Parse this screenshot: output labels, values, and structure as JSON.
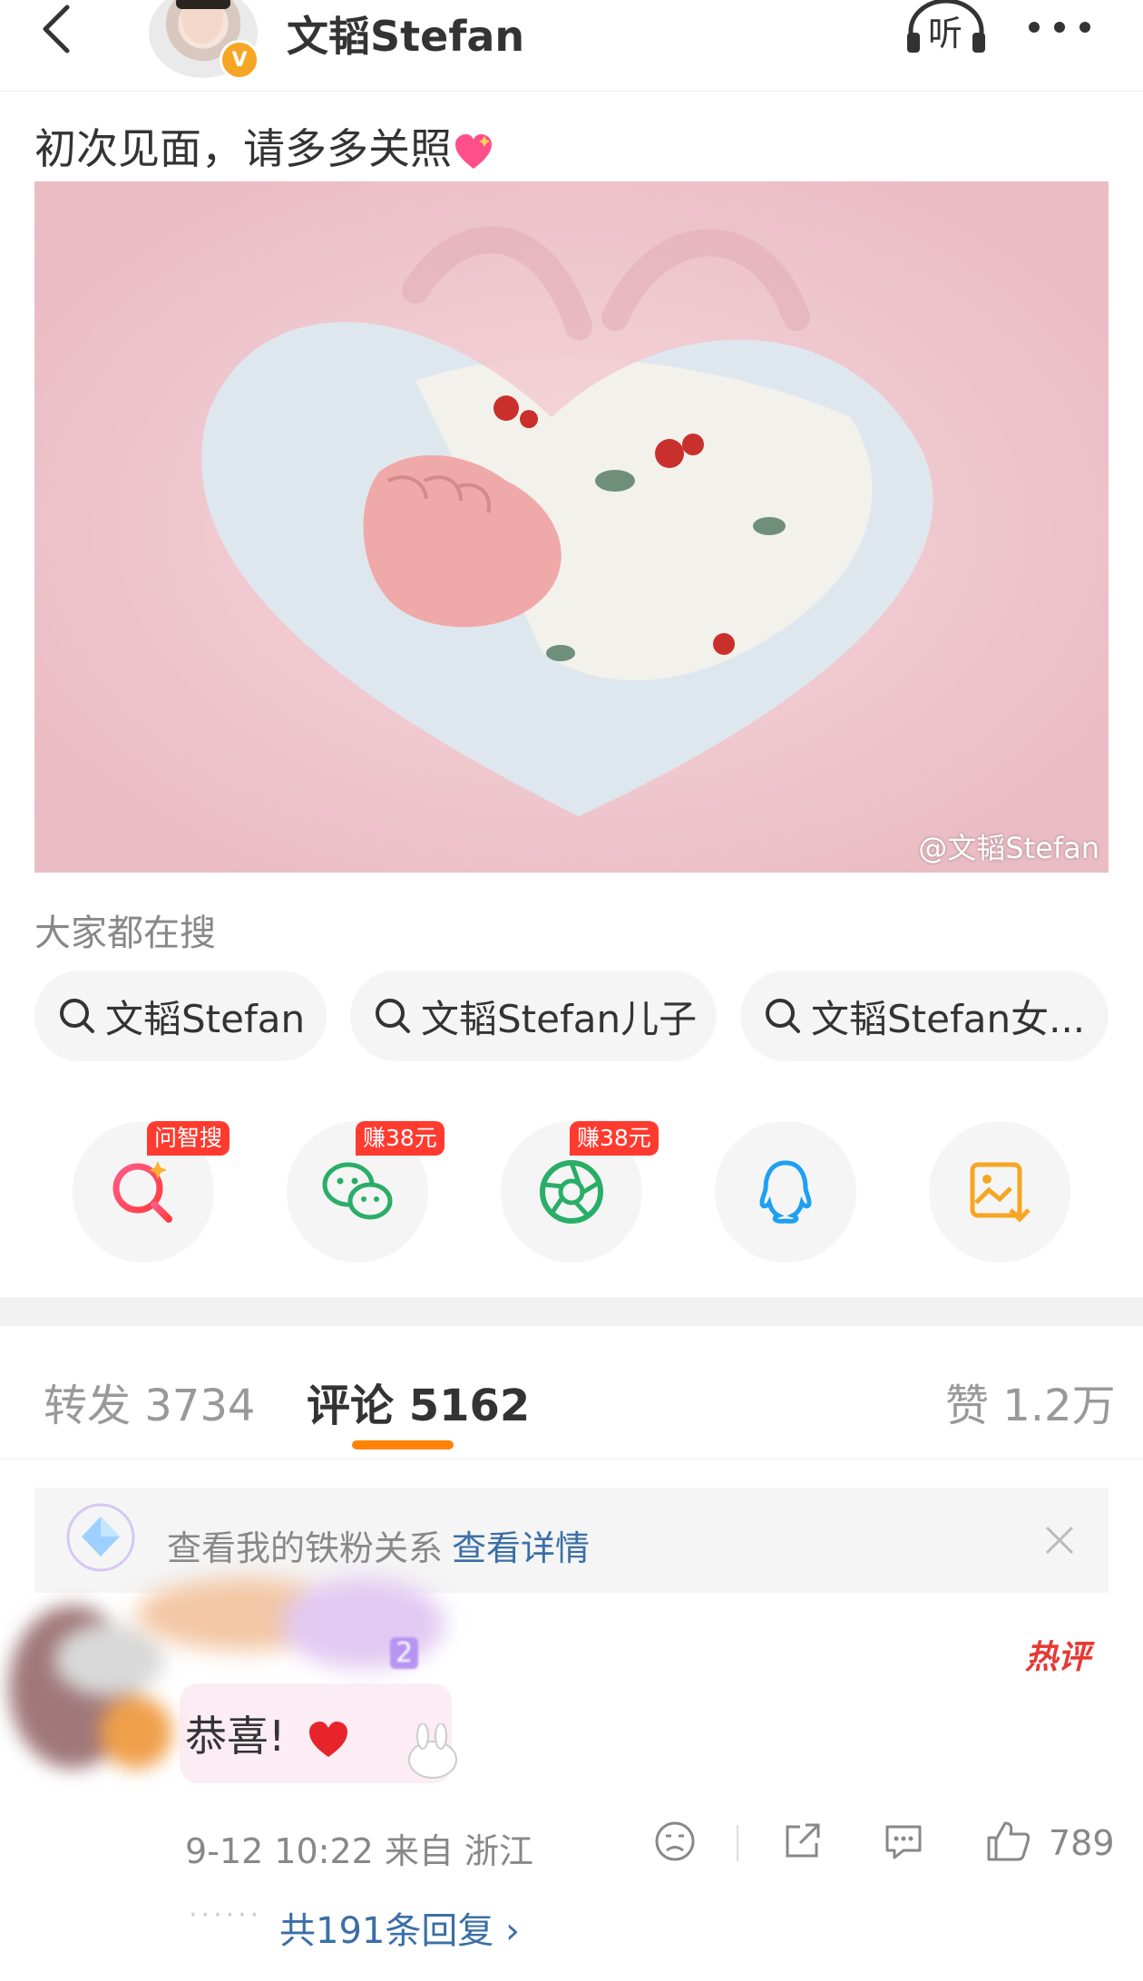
{
  "header": {
    "username": "文韬Stefan",
    "listen_label": "听",
    "verified_badge": "V"
  },
  "post": {
    "text": "初次见面，请多多关照",
    "watermark": "@文韬Stefan"
  },
  "search": {
    "title": "大家都在搜",
    "chips": [
      "文韬Stefan",
      "文韬Stefan儿子",
      "文韬Stefan女..."
    ]
  },
  "share": {
    "badges": [
      "问智搜",
      "赚38元",
      "赚38元"
    ],
    "icons": [
      "ai-search-icon",
      "wechat-icon",
      "moments-icon",
      "qq-icon",
      "save-image-icon"
    ]
  },
  "tabs": {
    "repost": "转发 3734",
    "comments": "评论 5162",
    "likes": "赞 1.2万"
  },
  "fan_bar": {
    "text": "查看我的铁粉关系",
    "link": "查看详情"
  },
  "comment": {
    "level": "2",
    "hot_tag": "热评",
    "text": "恭喜!",
    "time_location": "9-12 10:22 来自 浙江",
    "likes": "789",
    "replies": "共191条回复 ›",
    "reply_dots": "······"
  },
  "colors": {
    "accent": "#ff8200",
    "link": "#3b6fa6",
    "badge_red": "#ff3b30"
  }
}
